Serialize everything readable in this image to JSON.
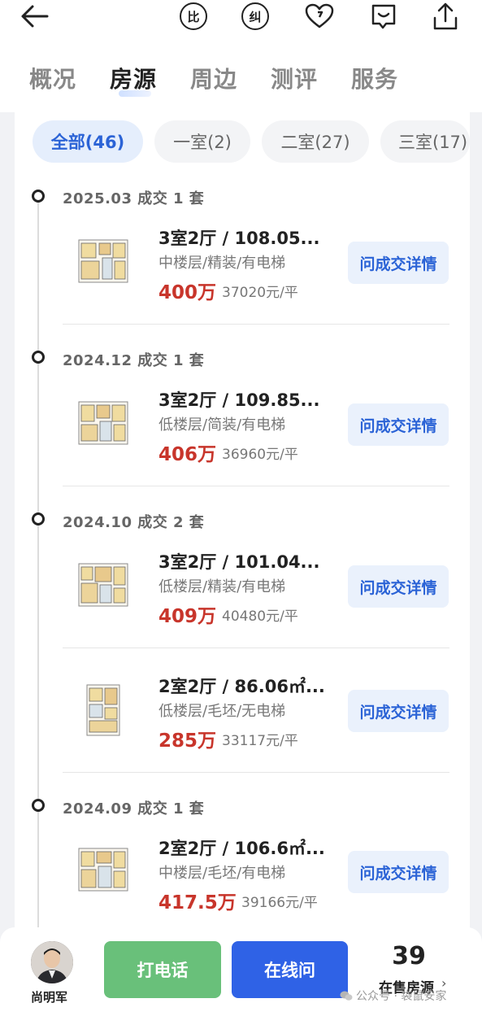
{
  "topbar": {
    "back_icon": "arrow-left-icon",
    "compare_label": "比",
    "correct_label": "纠",
    "favorite_icon": "heart-icon",
    "message_icon": "chat-icon",
    "share_icon": "upload-icon"
  },
  "tabs": [
    "概况",
    "房源",
    "周边",
    "测评",
    "服务"
  ],
  "active_tab": "房源",
  "filters": [
    "全部(46)",
    "一室(2)",
    "二室(27)",
    "三室(17)"
  ],
  "timeline": [
    {
      "date": "2025.03 成交 1 套",
      "listings": [
        {
          "title": "3室2厅 / 108.05...",
          "desc": "中楼层/精装/有电梯",
          "price": "400万",
          "unit_price": "37020元/平",
          "button": "问成交详情"
        }
      ]
    },
    {
      "date": "2024.12 成交 1 套",
      "listings": [
        {
          "title": "3室2厅 / 109.85...",
          "desc": "低楼层/简装/有电梯",
          "price": "406万",
          "unit_price": "36960元/平",
          "button": "问成交详情"
        }
      ]
    },
    {
      "date": "2024.10 成交 2 套",
      "listings": [
        {
          "title": "3室2厅 / 101.04...",
          "desc": "低楼层/精装/有电梯",
          "price": "409万",
          "unit_price": "40480元/平",
          "button": "问成交详情"
        },
        {
          "title": "2室2厅 / 86.06㎡...",
          "desc": "低楼层/毛坯/无电梯",
          "price": "285万",
          "unit_price": "33117元/平",
          "button": "问成交详情"
        }
      ]
    },
    {
      "date": "2024.09 成交 1 套",
      "listings": [
        {
          "title": "2室2厅 / 106.6㎡...",
          "desc": "中楼层/毛坯/有电梯",
          "price": "417.5万",
          "unit_price": "39166元/平",
          "button": "问成交详情"
        }
      ]
    }
  ],
  "bottom": {
    "agent_name": "尚明军",
    "call_label": "打电话",
    "online_label": "在线问",
    "onsale_count": "39",
    "onsale_label": "在售房源",
    "watermark": "公众号 · 袋鼠安家"
  },
  "colors": {
    "accent_blue": "#2f62e6",
    "price_red": "#c8352b",
    "call_green": "#69c07a"
  }
}
